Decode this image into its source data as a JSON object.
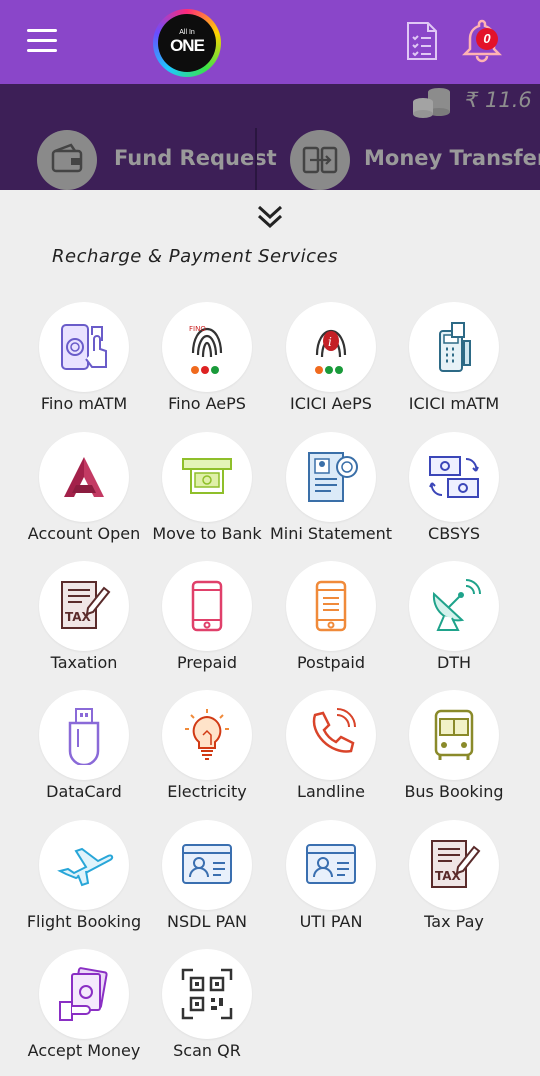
{
  "header": {
    "logo_small": "All In",
    "logo_big": "ONE",
    "notification_count": "0",
    "menu_icon": "hamburger-menu-icon",
    "doc_icon": "document-list-icon",
    "bell_icon": "bell-icon"
  },
  "balance": {
    "text": "₹ 11.6",
    "icon": "coins-stack-icon"
  },
  "actions": [
    {
      "label": "Fund Request",
      "icon": "wallet-icon"
    },
    {
      "label": "Money Transfer",
      "icon": "money-transfer-icon"
    }
  ],
  "section": {
    "title": "Recharge & Payment Services"
  },
  "colors": {
    "header": "#8a46c9",
    "balance_bar": "#3d1f57",
    "background": "#eeeeee"
  },
  "services": [
    {
      "label": "Fino mATM",
      "icon": "fingerprint-phone-icon"
    },
    {
      "label": "Fino AePS",
      "icon": "fino-fingerprint-icon"
    },
    {
      "label": "ICICI AePS",
      "icon": "icici-fingerprint-icon"
    },
    {
      "label": "ICICI mATM",
      "icon": "card-machine-icon"
    },
    {
      "label": "Account Open",
      "icon": "axis-logo-icon"
    },
    {
      "label": "Move to Bank",
      "icon": "atm-cash-icon"
    },
    {
      "label": "Mini Statement",
      "icon": "statement-icon"
    },
    {
      "label": "CBSYS",
      "icon": "currency-exchange-icon"
    },
    {
      "label": "Taxation",
      "icon": "tax-icon"
    },
    {
      "label": "Prepaid",
      "icon": "mobile-icon"
    },
    {
      "label": "Postpaid",
      "icon": "mobile-bill-icon"
    },
    {
      "label": "DTH",
      "icon": "satellite-dish-icon"
    },
    {
      "label": "DataCard",
      "icon": "usb-drive-icon"
    },
    {
      "label": "Electricity",
      "icon": "bulb-icon"
    },
    {
      "label": "Landline",
      "icon": "phone-icon"
    },
    {
      "label": "Bus Booking",
      "icon": "bus-icon"
    },
    {
      "label": "Flight Booking",
      "icon": "airplane-icon"
    },
    {
      "label": "NSDL PAN",
      "icon": "id-card-icon"
    },
    {
      "label": "UTI PAN",
      "icon": "id-card-icon"
    },
    {
      "label": "Tax Pay",
      "icon": "tax-icon"
    },
    {
      "label": "Accept Money",
      "icon": "cash-hand-icon"
    },
    {
      "label": "Scan QR",
      "icon": "qr-code-icon"
    }
  ]
}
